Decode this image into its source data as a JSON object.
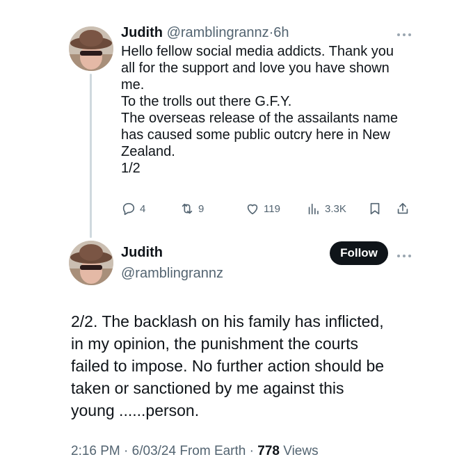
{
  "tweet1": {
    "name": "Judith",
    "handle": "@ramblingrannz",
    "separator": "·",
    "time": "6h",
    "more_icon": "ellipsis-icon",
    "lines": [
      "Hello fellow social media addicts. Thank you",
      "all for the support and love you have shown",
      "me.",
      "To the trolls out there G.F.Y.",
      "The overseas release of the assailants name",
      "has caused some public outcry here in New",
      "Zealand.",
      "1/2"
    ],
    "actions": {
      "replies": "4",
      "reposts": "9",
      "likes": "119",
      "views": "3.3K"
    }
  },
  "tweet2": {
    "name": "Judith",
    "handle": "@ramblingrannz",
    "follow_label": "Follow",
    "lines": [
      "2/2. The backlash on his family has inflicted,",
      "in my opinion, the punishment the courts",
      "failed to impose. No further action should be",
      "taken or sanctioned by me against this",
      "young ......person."
    ],
    "meta": {
      "time": "2:16 PM",
      "sep1": " · ",
      "date": "6/03/24",
      "source": " From Earth",
      "sep2": " · ",
      "views_count": "778",
      "views_label": " Views"
    }
  },
  "colors": {
    "text": "#0f1419",
    "muted": "#536471",
    "thread_line": "#cfd9de",
    "follow_bg": "#0f1419"
  }
}
